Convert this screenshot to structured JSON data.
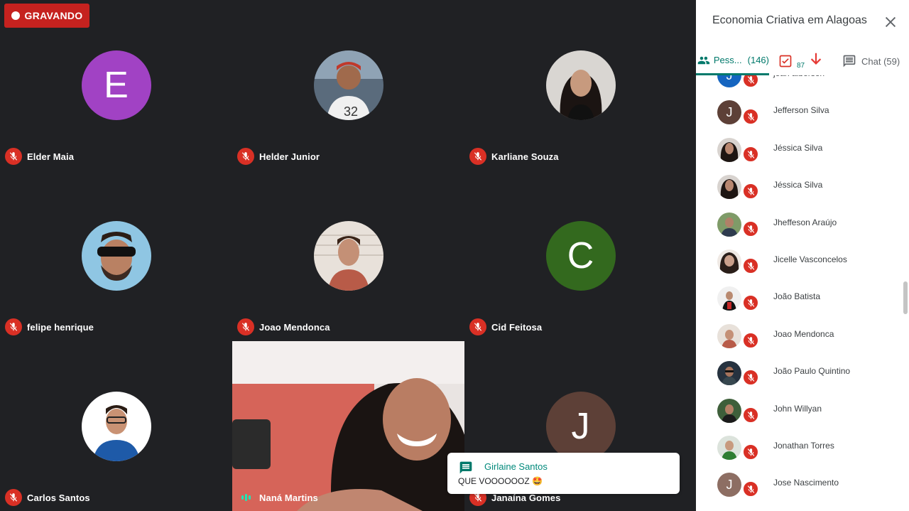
{
  "recording": {
    "label": "GRAVANDO"
  },
  "tiles": [
    {
      "name": "Elder Maia",
      "initial": "E",
      "color": "#a142c4"
    },
    {
      "name": "Helder Junior",
      "photo": "helder"
    },
    {
      "name": "Karliane Souza",
      "photo": "karliane"
    },
    {
      "name": "felipe henrique",
      "photo": "felipe"
    },
    {
      "name": "Joao Mendonca",
      "photo": "joao"
    },
    {
      "name": "Cid Feitosa",
      "initial": "C",
      "color": "#33691e"
    },
    {
      "name": "Carlos Santos",
      "photo": "carlos"
    },
    {
      "name": "Naná Martins",
      "video": true
    },
    {
      "name": "Janaína Gomes",
      "initial": "J",
      "color": "#5d4037"
    }
  ],
  "toast": {
    "sender": "Girlaine Santos",
    "message": "QUE VOOOOOOZ 🤩"
  },
  "panel": {
    "title": "Economia Criativa em Alagoas",
    "tabs": {
      "people_label": "Pess...",
      "people_count": "(146)",
      "tasks_badge": "87",
      "chat_label": "Chat (59)"
    },
    "people": [
      {
        "name": "jean alberson",
        "initial": "J",
        "color": "#1565c0"
      },
      {
        "name": "Jefferson Silva",
        "initial": "J",
        "color": "#5d4037"
      },
      {
        "name": "Jéssica Silva",
        "photo": "f1"
      },
      {
        "name": "Jéssica Silva",
        "photo": "f1"
      },
      {
        "name": "Jheffeson Araújo",
        "photo": "m1"
      },
      {
        "name": "Jicelle Vasconcelos",
        "photo": "f2"
      },
      {
        "name": "João Batista",
        "photo": "m2"
      },
      {
        "name": "Joao Mendonca",
        "photo": "m3"
      },
      {
        "name": "João Paulo Quintino",
        "photo": "m4"
      },
      {
        "name": "John Willyan",
        "photo": "m5"
      },
      {
        "name": "Jonathan Torres",
        "photo": "m6"
      },
      {
        "name": "Jose Nascimento",
        "initial": "J",
        "color": "#8d6e63"
      }
    ]
  }
}
